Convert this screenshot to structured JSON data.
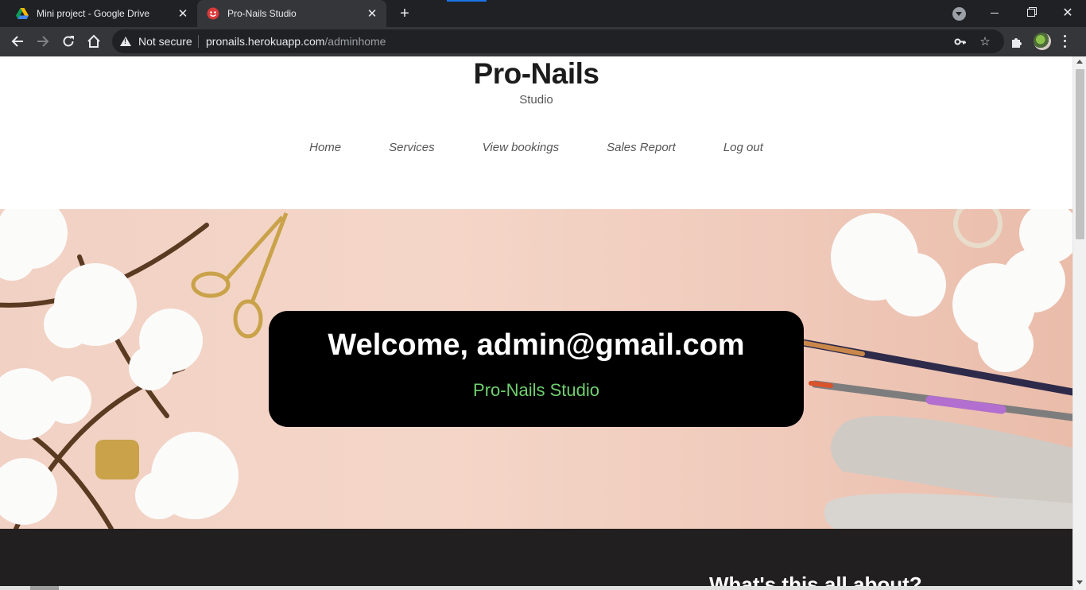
{
  "browser": {
    "tabs": [
      {
        "title": "Mini project - Google Drive",
        "active": false,
        "icon": "google-drive-icon"
      },
      {
        "title": "Pro-Nails Studio",
        "active": true,
        "icon": "pro-nails-favicon"
      }
    ],
    "security_label": "Not secure",
    "url_host": "pronails.herokuapp.com",
    "url_path": "/adminhome"
  },
  "site": {
    "brand": "Pro-Nails",
    "brand_sub": "Studio",
    "nav": [
      "Home",
      "Services",
      "View bookings",
      "Sales Report",
      "Log out"
    ]
  },
  "hero": {
    "welcome": "Welcome, admin@gmail.com",
    "subtitle": "Pro-Nails Studio"
  },
  "section": {
    "heading": "What's this all about?"
  },
  "colors": {
    "accent_green": "#6fcf6f",
    "dark_section": "#221f20",
    "hero_bg": "#f4d6c8"
  }
}
